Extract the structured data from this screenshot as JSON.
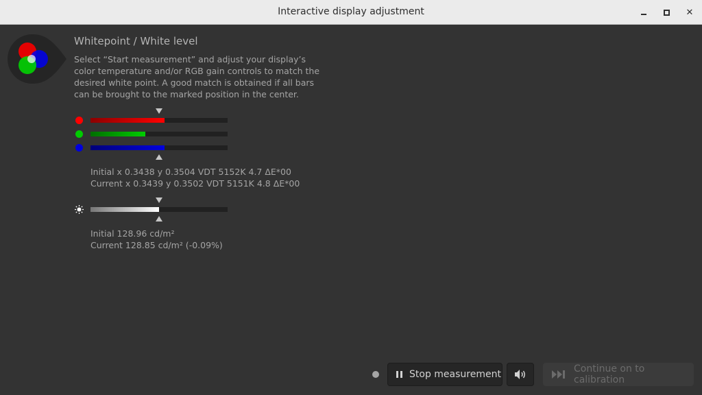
{
  "window": {
    "title": "Interactive display adjustment"
  },
  "section": {
    "heading": "Whitepoint / White level",
    "description": "Select “Start measurement” and adjust your display’s color temperature and/or RGB gain controls to match the desired white point. A good match is obtained if all bars can be brought to the marked position in the center."
  },
  "rgb_bars": [
    {
      "channel": "red",
      "color": "#ff0000",
      "level_percent": 54
    },
    {
      "channel": "green",
      "color": "#00cc00",
      "level_percent": 40
    },
    {
      "channel": "blue",
      "color": "#0000dd",
      "level_percent": 54
    }
  ],
  "whitepoint_readout": {
    "initial": "Initial x 0.3438 y 0.3504 VDT 5152K 4.7 ΔE*00",
    "current": "Current x 0.3439 y 0.3502 VDT 5151K 4.8 ΔE*00"
  },
  "luminance_bar": {
    "icon": "brightness-icon",
    "level_percent": 50
  },
  "luminance_readout": {
    "initial": "Initial 128.96 cd/m²",
    "current": "Current 128.85 cd/m² (-0.09%)"
  },
  "footer": {
    "stop_label": "Stop measurement",
    "continue_label": "Continue on to calibration",
    "stop_icon": "pause-icon",
    "sound_icon": "speaker-icon",
    "continue_icon": "skip-forward-icon"
  }
}
